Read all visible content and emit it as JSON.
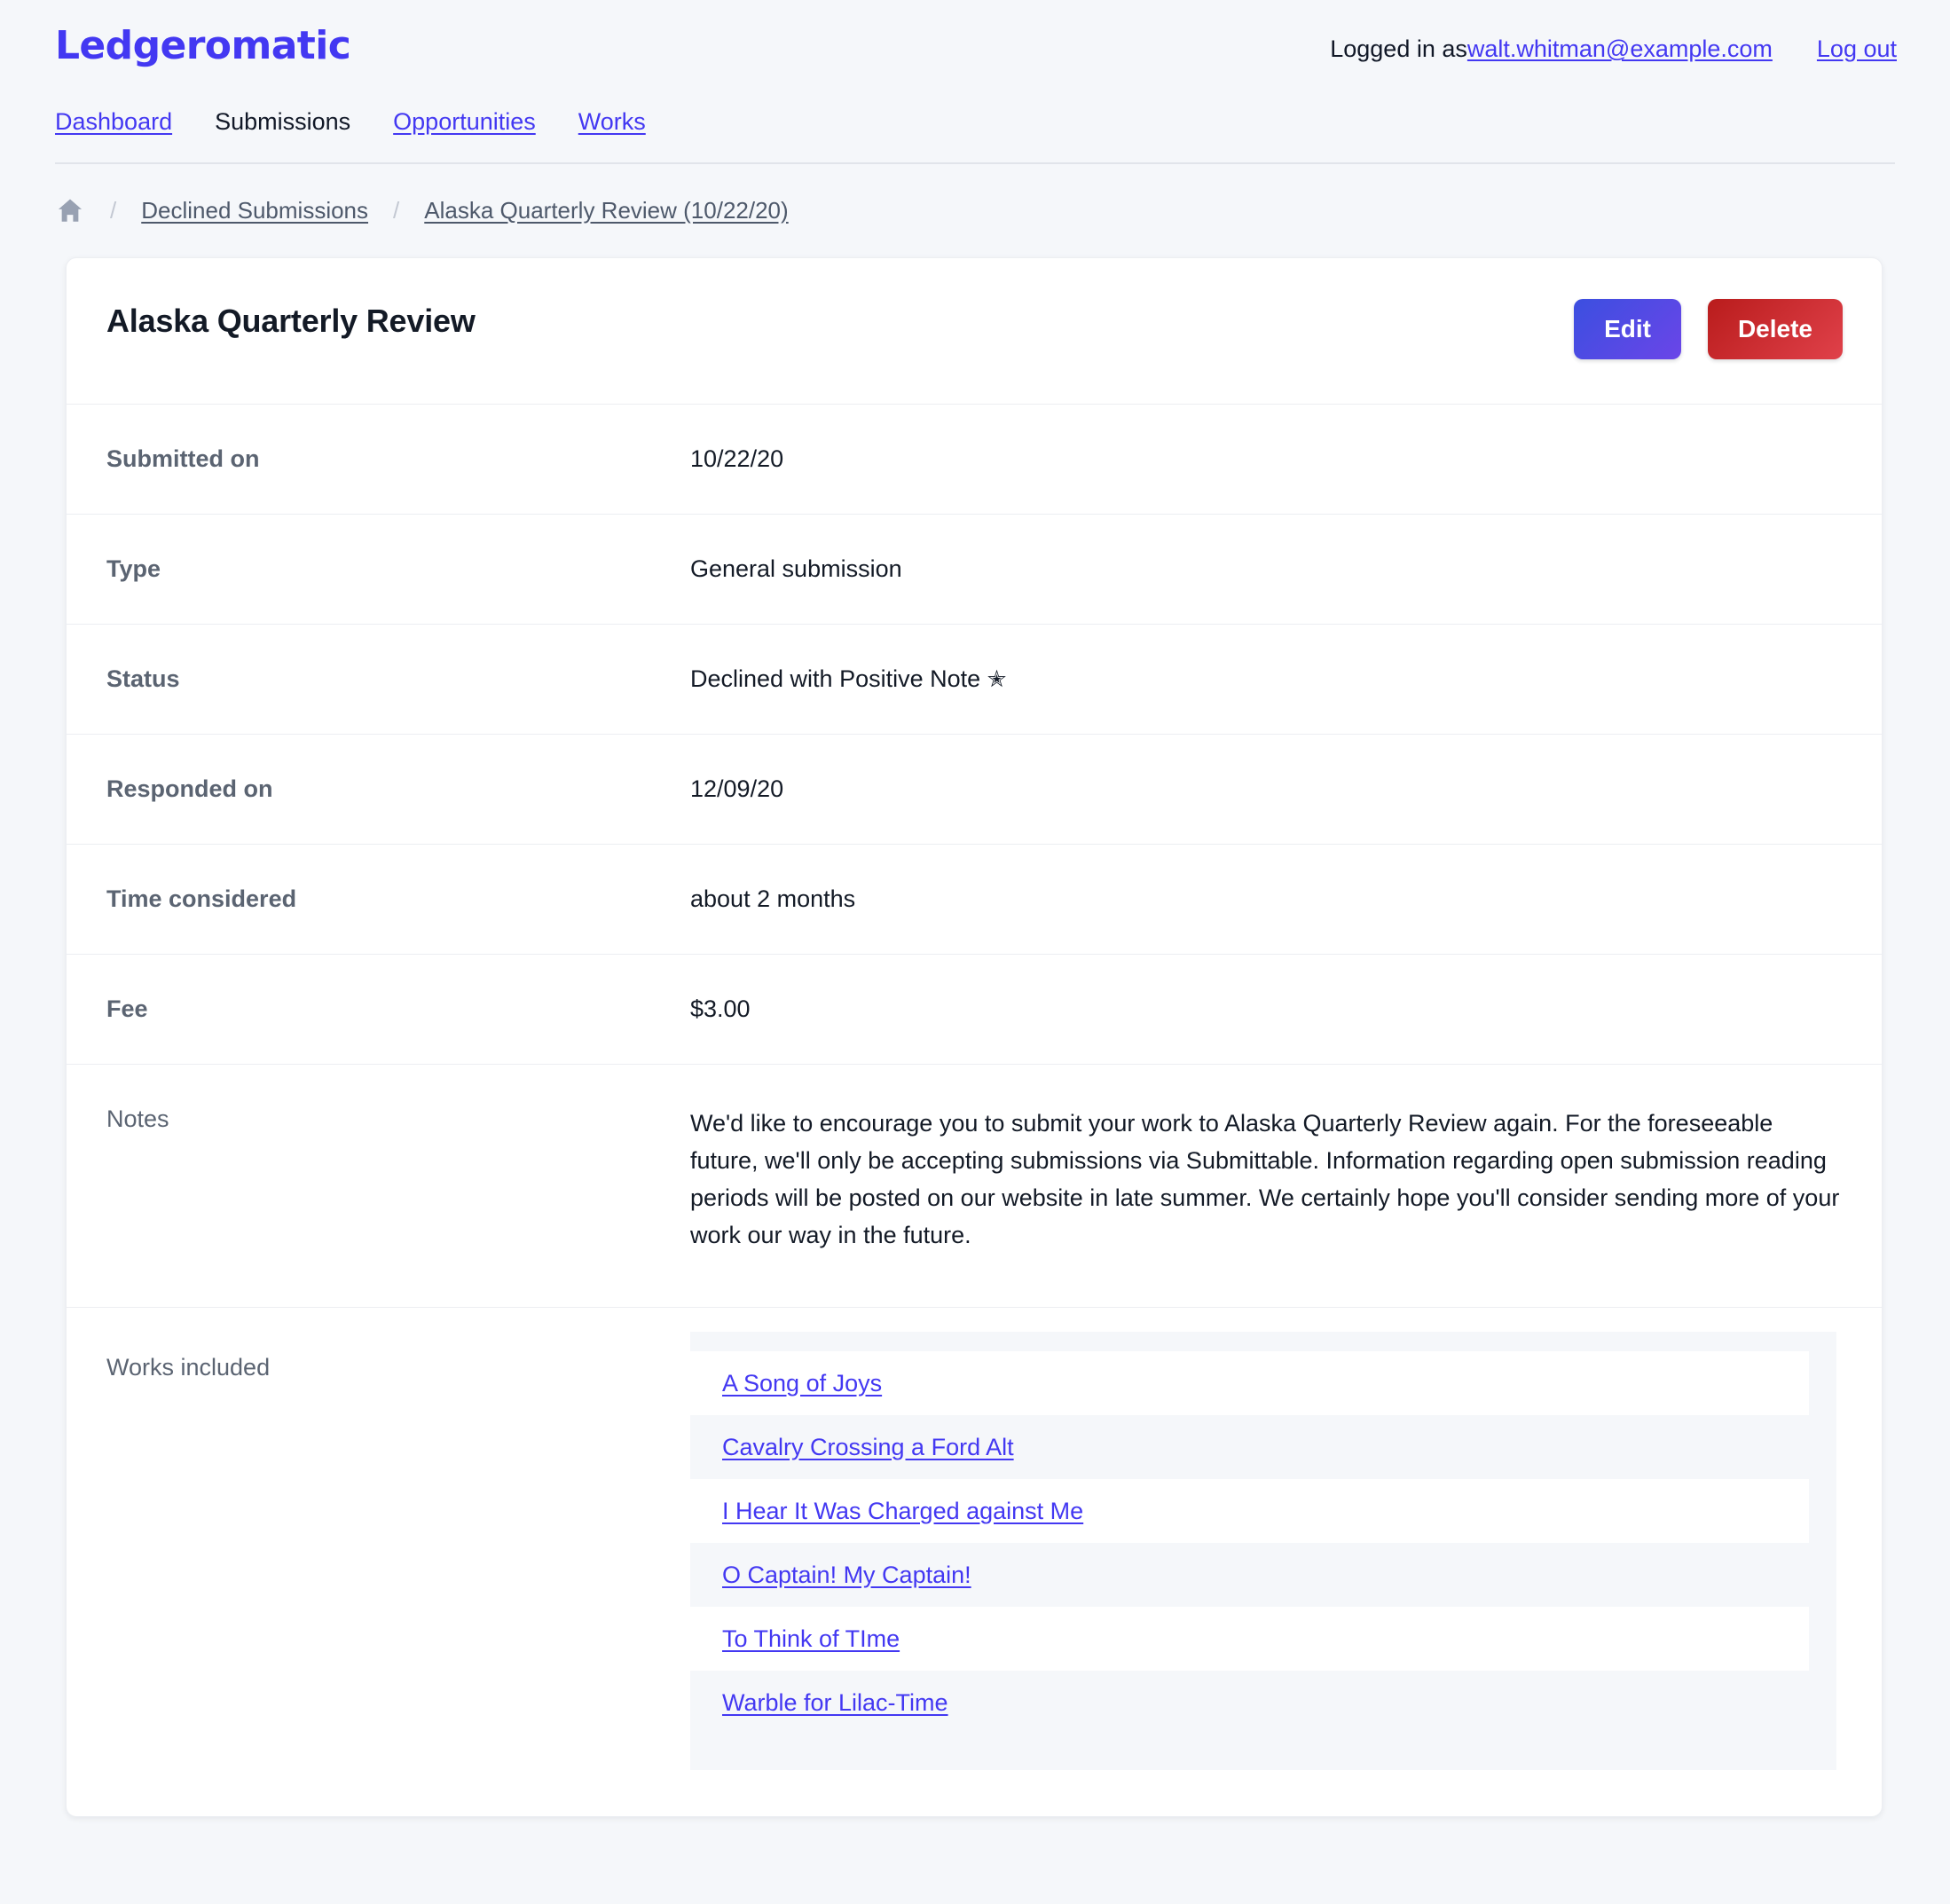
{
  "brand": "Ledgeromatic",
  "account": {
    "logged_in_label": "Logged in as ",
    "email": "walt.whitman@example.com",
    "logout_label": "Log out"
  },
  "nav": {
    "items": [
      {
        "label": "Dashboard",
        "current": false
      },
      {
        "label": "Submissions",
        "current": true
      },
      {
        "label": "Opportunities",
        "current": false
      },
      {
        "label": "Works",
        "current": false
      }
    ]
  },
  "breadcrumb": {
    "home_icon": "home-icon",
    "separator": "/",
    "items": [
      {
        "label": "Declined Submissions"
      },
      {
        "label": "Alaska Quarterly Review (10/22/20)"
      }
    ]
  },
  "card": {
    "title": "Alaska Quarterly Review",
    "edit_label": "Edit",
    "delete_label": "Delete",
    "rows": [
      {
        "label": "Submitted on",
        "value": "10/22/20"
      },
      {
        "label": "Type",
        "value": "General submission"
      },
      {
        "label": "Status",
        "value": "Declined with Positive Note",
        "badge": "✭"
      },
      {
        "label": "Responded on",
        "value": "12/09/20"
      },
      {
        "label": "Time considered",
        "value": "about 2 months"
      },
      {
        "label": "Fee",
        "value": "$3.00"
      }
    ],
    "notes": {
      "label": "Notes",
      "text": "We'd like to encourage you to submit your work to Alaska Quarterly Review again. For the foreseeable future, we'll only be accepting submissions via Submittable. Information regarding open submission reading periods will be posted on our website in late summer. We certainly hope you'll consider sending more of your work our way in the future."
    },
    "works": {
      "label": "Works included",
      "items": [
        "A Song of Joys",
        "Cavalry Crossing a Ford Alt",
        "I Hear It Was Charged against Me",
        "O Captain! My Captain!",
        "To Think of TIme",
        "Warble for Lilac-Time"
      ]
    }
  },
  "colors": {
    "brand": "#4338f2",
    "link": "#4338f2",
    "breadcrumb_link": "#4e596b",
    "label": "#5b6472",
    "value": "#131a26",
    "page_bg": "#f5f7fa",
    "edit_button": "#4f46e5",
    "delete_button": "#cf2233"
  }
}
